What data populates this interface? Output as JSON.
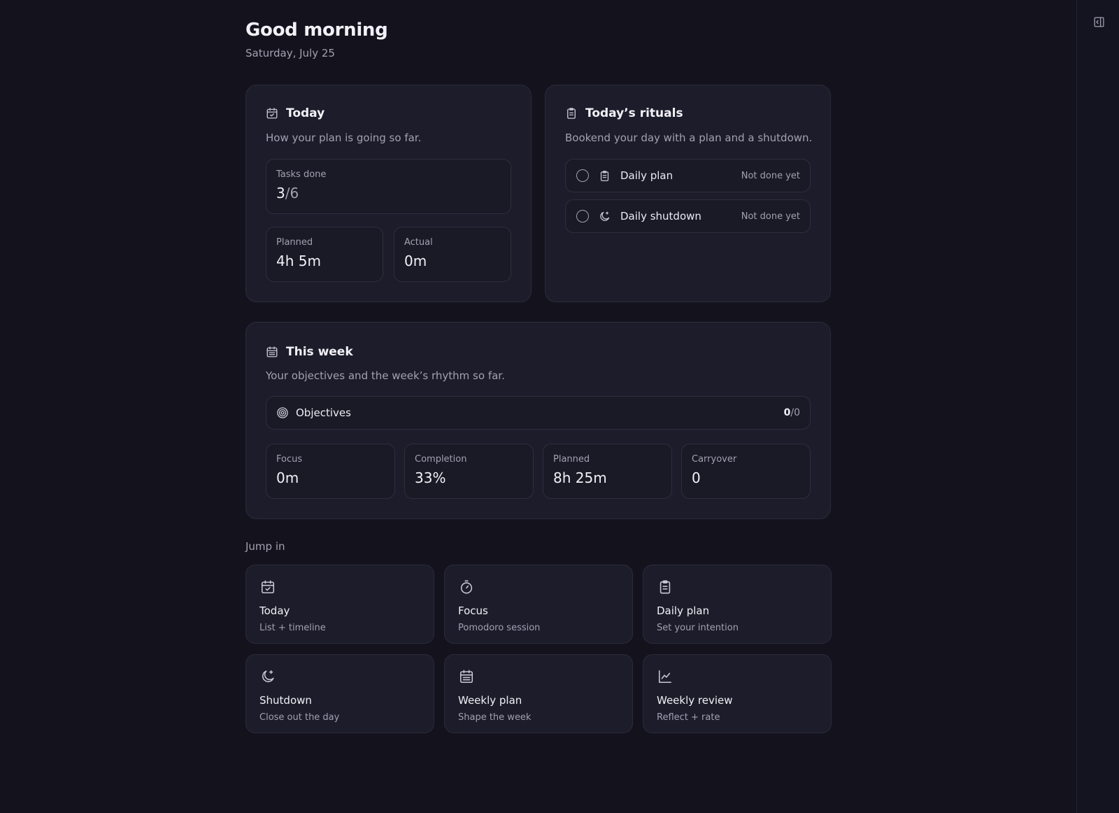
{
  "header": {
    "greeting": "Good morning",
    "date": "Saturday, July 25"
  },
  "today_card": {
    "title": "Today",
    "subtitle": "How your plan is going so far.",
    "tasks": {
      "label": "Tasks done",
      "done": "3",
      "separator": "/",
      "total": "6"
    },
    "planned": {
      "label": "Planned",
      "value": "4h 5m"
    },
    "actual": {
      "label": "Actual",
      "value": "0m"
    }
  },
  "rituals_card": {
    "title": "Today’s rituals",
    "subtitle": "Bookend your day with a plan and a shutdown.",
    "items": [
      {
        "name": "Daily plan",
        "status": "Not done yet",
        "icon": "clipboard-icon"
      },
      {
        "name": "Daily shutdown",
        "status": "Not done yet",
        "icon": "moon-icon"
      }
    ]
  },
  "week_card": {
    "title": "This week",
    "subtitle": "Your objectives and the week’s rhythm so far.",
    "objectives": {
      "label": "Objectives",
      "done": "0",
      "separator": "/",
      "total": "0"
    },
    "stats": [
      {
        "label": "Focus",
        "value": "0m"
      },
      {
        "label": "Completion",
        "value": "33%"
      },
      {
        "label": "Planned",
        "value": "8h 25m"
      },
      {
        "label": "Carryover",
        "value": "0"
      }
    ]
  },
  "jump_in": {
    "label": "Jump in",
    "tiles": [
      {
        "name": "Today",
        "desc": "List + timeline",
        "icon": "calendar-check-icon"
      },
      {
        "name": "Focus",
        "desc": "Pomodoro session",
        "icon": "timer-icon"
      },
      {
        "name": "Daily plan",
        "desc": "Set your intention",
        "icon": "clipboard-icon"
      },
      {
        "name": "Shutdown",
        "desc": "Close out the day",
        "icon": "moon-icon"
      },
      {
        "name": "Weekly plan",
        "desc": "Shape the week",
        "icon": "calendar-icon"
      },
      {
        "name": "Weekly review",
        "desc": "Reflect + rate",
        "icon": "chart-line-icon"
      }
    ]
  },
  "colors": {
    "background": "#13121d",
    "card": "#1d1c2a",
    "border": "#2c2b3a",
    "text": "#ecebf3",
    "muted": "#a3a1b1"
  }
}
